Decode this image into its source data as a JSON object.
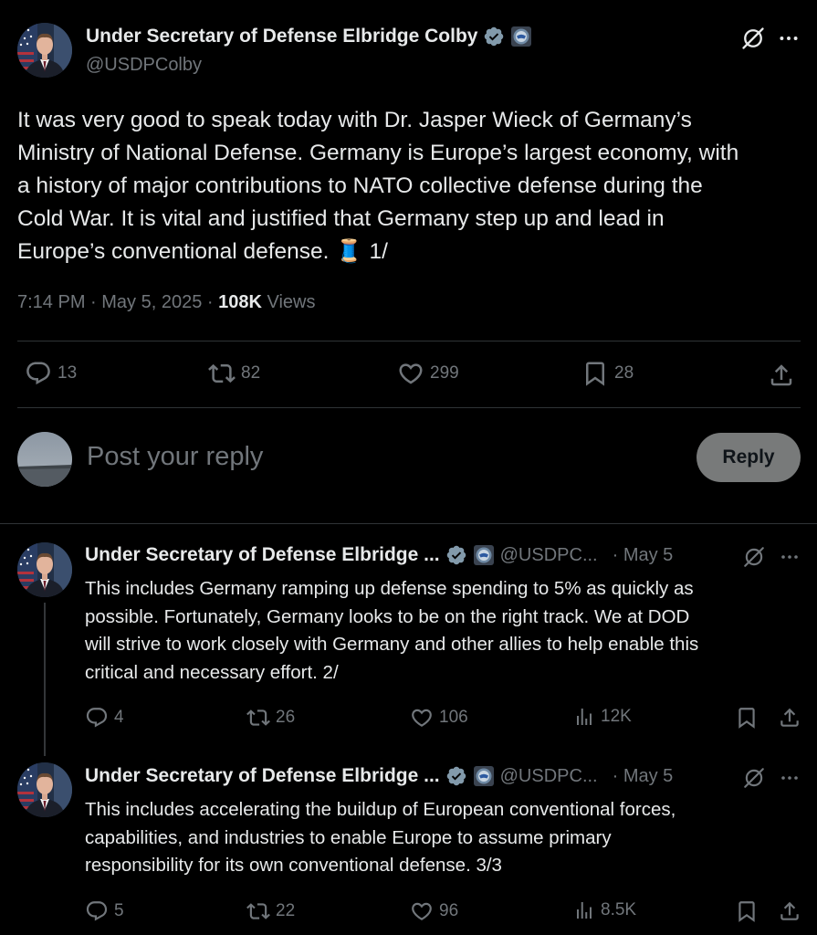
{
  "main_post": {
    "author_name": "Under Secretary of Defense Elbridge Colby",
    "handle": "@USDPColby",
    "text_lines": [
      "It was very good to speak today with Dr. Jasper Wieck of Germany’s",
      "Ministry of National Defense. Germany is Europe’s largest economy, with",
      "a history of major contributions to NATO collective defense during the",
      "Cold War. It is vital and justified that Germany step up and lead in",
      "Europe’s conventional defense. 🧵 1/"
    ],
    "time": "7:14 PM · May 5, 2025 ·",
    "views_count": "108K",
    "views_label": "Views",
    "replies": "13",
    "reposts": "82",
    "likes": "299",
    "bookmarks": "28"
  },
  "composer": {
    "placeholder": "Post your reply",
    "button_label": "Reply"
  },
  "thread_replies": [
    {
      "author_name": "Under Secretary of Defense Elbridge ...",
      "handle": "@USDPC...",
      "date": "· May 5",
      "text_lines": [
        "This includes Germany ramping up defense spending to 5% as quickly as",
        "possible. Fortunately, Germany looks to be on the right track. We at DOD",
        "will strive to work closely with Germany and other allies to help enable this",
        "critical and necessary effort. 2/"
      ],
      "replies": "4",
      "reposts": "26",
      "likes": "106",
      "views": "12K"
    },
    {
      "author_name": "Under Secretary of Defense Elbridge ...",
      "handle": "@USDPC...",
      "date": "· May 5",
      "text_lines": [
        "This includes accelerating the buildup of European conventional forces,",
        "capabilities, and industries to enable Europe to assume primary",
        "responsibility for its own conventional defense. 3/3"
      ],
      "replies": "5",
      "reposts": "22",
      "likes": "96",
      "views": "8.5K"
    }
  ],
  "colors": {
    "background": "#000000",
    "text": "#e7e9ea",
    "secondary": "#71767b",
    "verified": "#829aab",
    "reply_button": "#787a7a"
  },
  "icons": [
    "verified-badge-icon",
    "government-affiliation-icon",
    "grok-icon",
    "more-icon",
    "reply-icon",
    "repost-icon",
    "like-icon",
    "bookmark-icon",
    "share-icon",
    "views-icon"
  ]
}
